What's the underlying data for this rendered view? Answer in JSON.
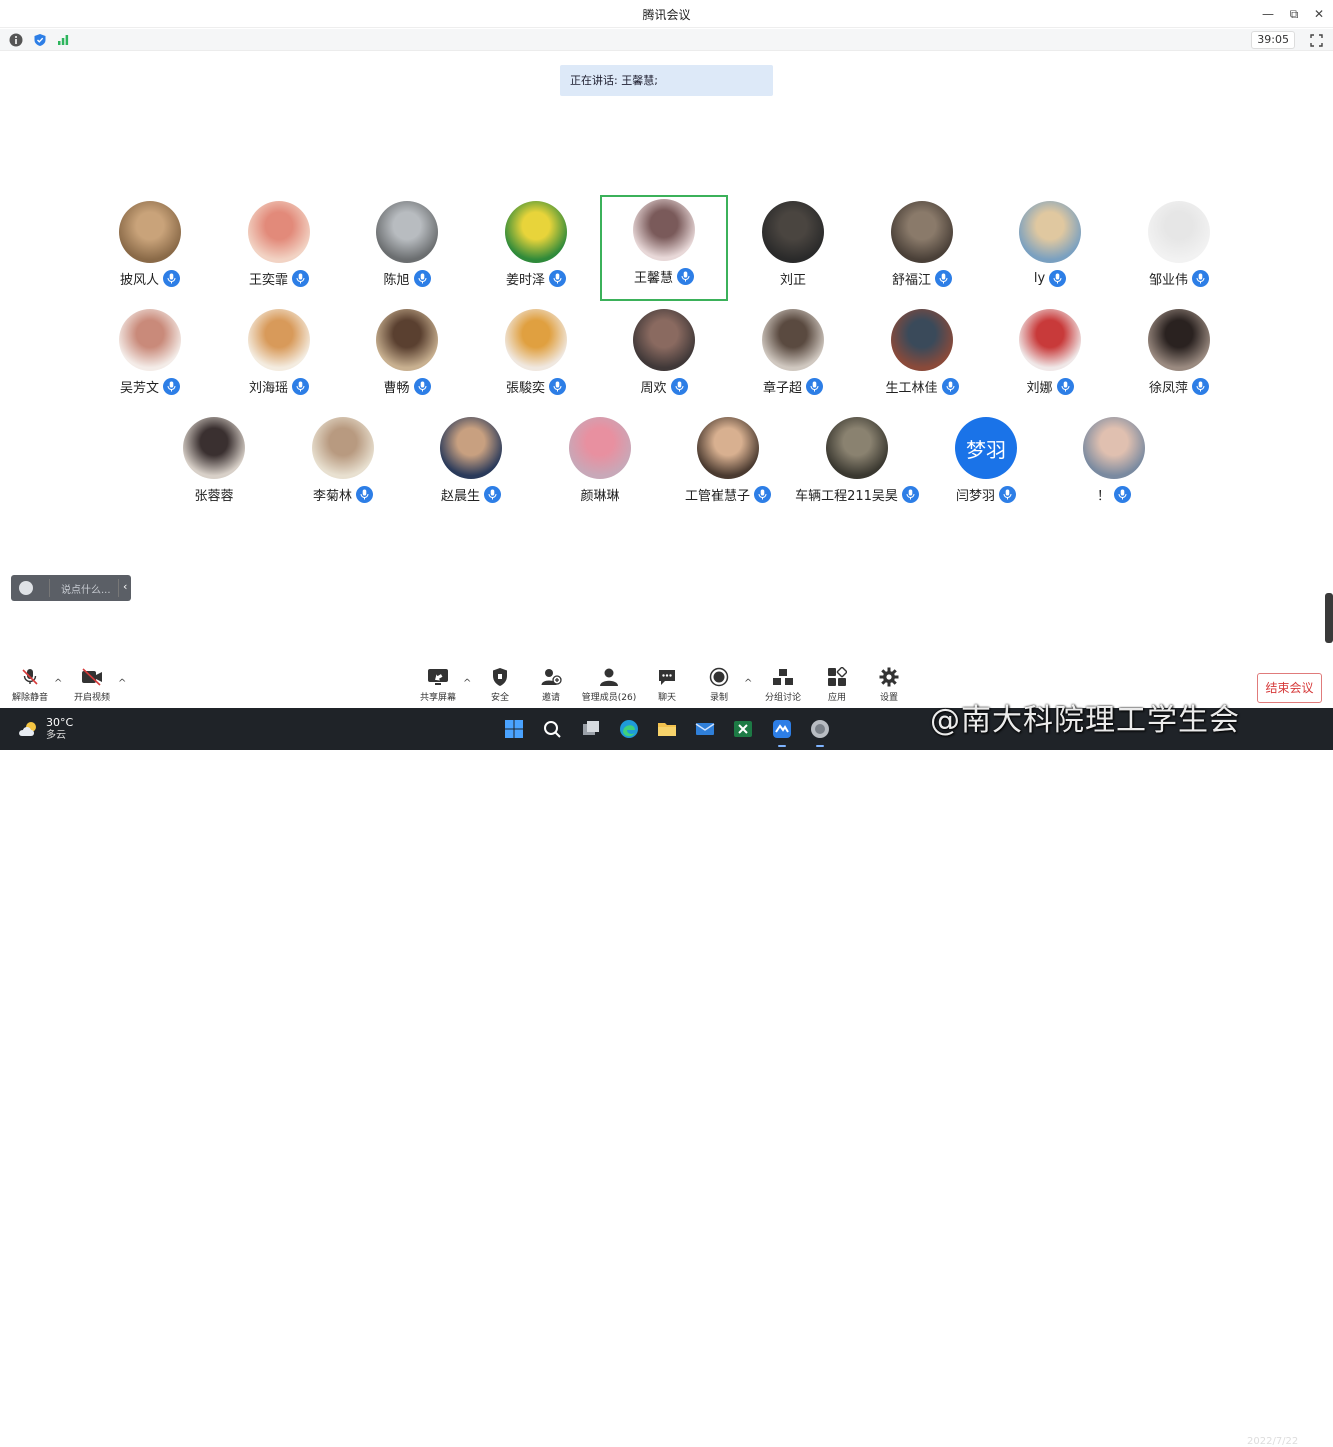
{
  "window": {
    "title": "腾讯会议",
    "minimize": "—",
    "restore": "⧉",
    "close": "✕"
  },
  "infobar": {
    "timer": "39:05"
  },
  "speaking": "正在讲话: 王馨慧;",
  "participants": [
    {
      "name": "披风人",
      "mic": true
    },
    {
      "name": "王奕霏",
      "mic": true
    },
    {
      "name": "陈旭",
      "mic": true
    },
    {
      "name": "姜时泽",
      "mic": true
    },
    {
      "name": "王馨慧",
      "mic": true,
      "active": true
    },
    {
      "name": "刘正",
      "mic": false
    },
    {
      "name": "舒福江",
      "mic": true
    },
    {
      "name": "ly",
      "mic": true
    },
    {
      "name": "邹业伟",
      "mic": true
    },
    {
      "name": "吴芳文",
      "mic": true
    },
    {
      "name": "刘海瑶",
      "mic": true
    },
    {
      "name": "曹畅",
      "mic": true
    },
    {
      "name": "張駿奕",
      "mic": true
    },
    {
      "name": "周欢",
      "mic": true
    },
    {
      "name": "章子超",
      "mic": true
    },
    {
      "name": "生工林佳",
      "mic": true
    },
    {
      "name": "刘娜",
      "mic": true
    },
    {
      "name": "徐凤萍",
      "mic": true
    },
    {
      "name": "张蓉蓉",
      "mic": false
    },
    {
      "name": "李菊林",
      "mic": true
    },
    {
      "name": "赵晨生",
      "mic": true
    },
    {
      "name": "颜琳琳",
      "mic": false
    },
    {
      "name": "工管崔慧子",
      "mic": true
    },
    {
      "name": "车辆工程211吴昊",
      "mic": true
    },
    {
      "name": "闫梦羽",
      "mic": true,
      "initials": "梦羽"
    },
    {
      "name": "！",
      "mic": true
    }
  ],
  "chat": {
    "placeholder": "说点什么..."
  },
  "toolbar": {
    "unmute": "解除静音",
    "video": "开启视频",
    "share": "共享屏幕",
    "security": "安全",
    "invite": "邀请",
    "members": "管理成员(26)",
    "chat": "聊天",
    "record": "录制",
    "breakout": "分组讨论",
    "apps": "应用",
    "settings": "设置",
    "end": "结束会议"
  },
  "taskbar": {
    "temp": "30°C",
    "weather": "多云",
    "date": "2022/7/22",
    "watermark": "@南大科院理工学生会"
  },
  "colors": {
    "accent": "#2d7ee6",
    "active_border": "#3bb15a",
    "end_red": "#d63a3a"
  }
}
